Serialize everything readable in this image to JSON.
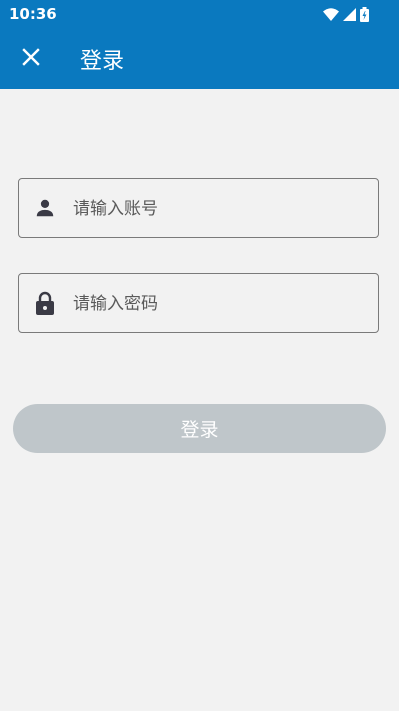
{
  "status_bar": {
    "time": "10:36",
    "icons": [
      "wifi-icon",
      "signal-icon",
      "battery-icon"
    ]
  },
  "app_bar": {
    "title": "登录",
    "close_icon": "close-icon",
    "background_color": "#0a79bf"
  },
  "form": {
    "account": {
      "icon": "person-icon",
      "placeholder": "请输入账号",
      "value": ""
    },
    "password": {
      "icon": "lock-icon",
      "placeholder": "请输入密码",
      "value": ""
    },
    "login_button": {
      "label": "登录",
      "color": "#bfc6ca"
    }
  }
}
